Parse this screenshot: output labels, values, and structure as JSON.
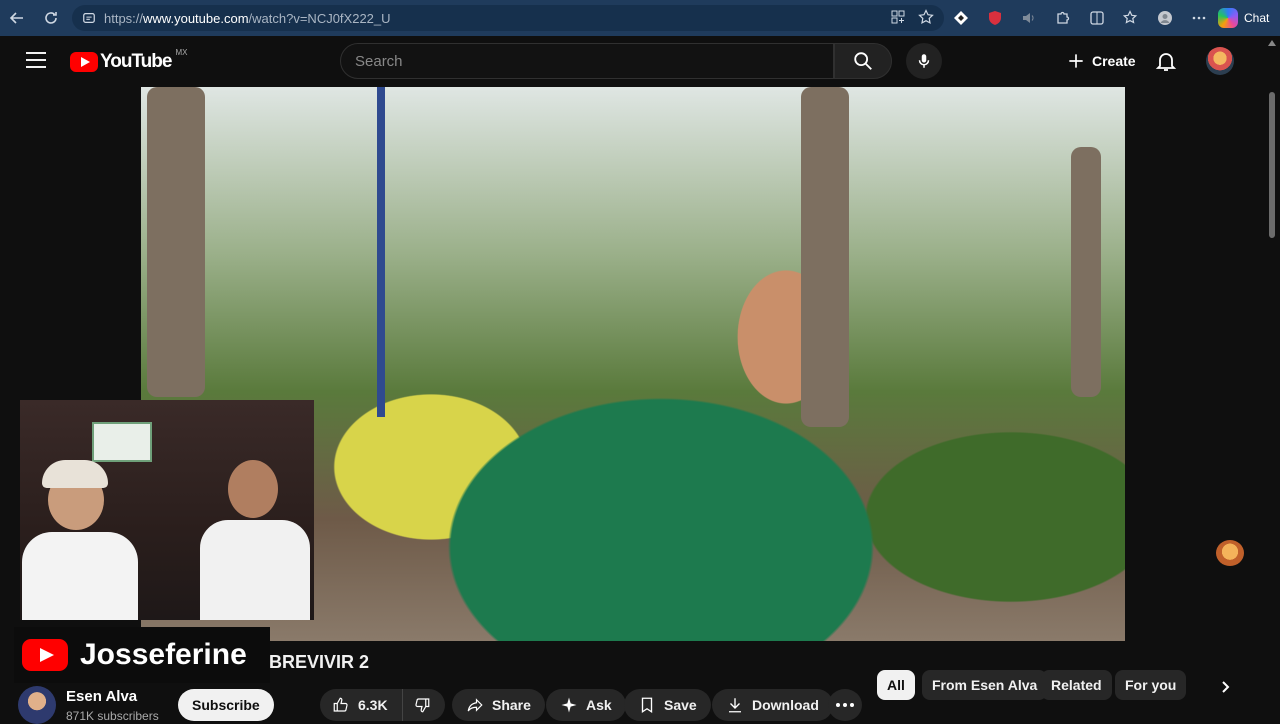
{
  "browser": {
    "url_prefix": "https://",
    "url_domain": "www.youtube.com",
    "url_path": "/watch?v=NCJ0fX222_U",
    "chat_label": "Chat"
  },
  "header": {
    "logo_text": "YouTube",
    "country_code": "MX",
    "search_placeholder": "Search",
    "create_label": "Create"
  },
  "overlay": {
    "channel_name": "Josseferine"
  },
  "video": {
    "title_visible": "BREVIVIR 2",
    "channel_name": "Esen Alva",
    "subscribers": "871K subscribers",
    "subscribe_label": "Subscribe",
    "like_count": "6.3K",
    "share_label": "Share",
    "ask_label": "Ask",
    "save_label": "Save",
    "download_label": "Download"
  },
  "chips": [
    {
      "label": "All"
    },
    {
      "label": "From Esen Alva"
    },
    {
      "label": "Related"
    },
    {
      "label": "For you"
    }
  ]
}
